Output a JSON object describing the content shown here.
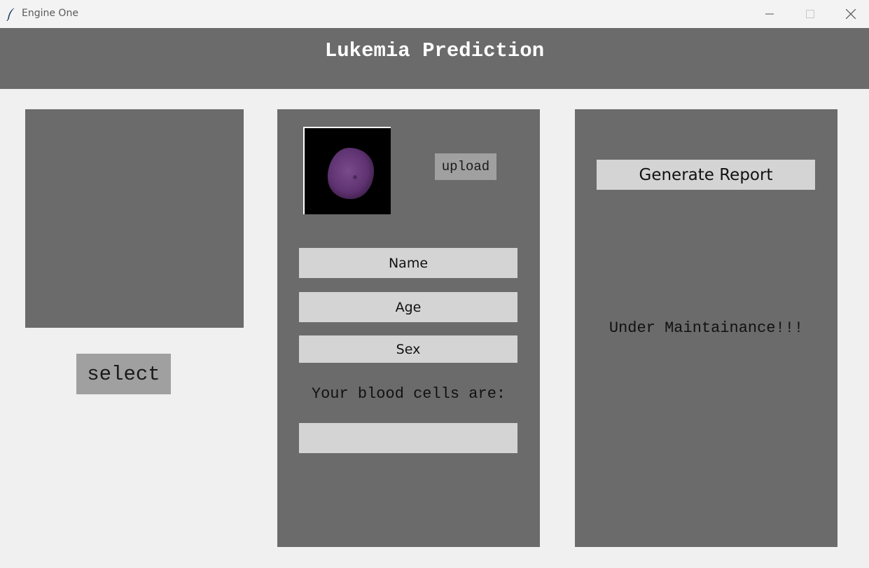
{
  "window": {
    "title": "Engine One",
    "controls": [
      "minimize-icon",
      "maximize-icon",
      "close-icon"
    ]
  },
  "header": {
    "title": "Lukemia Prediction"
  },
  "left_panel": {
    "select_label": "select"
  },
  "middle_panel": {
    "upload_label": "upload",
    "name_placeholder": "Name",
    "age_placeholder": "Age",
    "sex_placeholder": "Sex",
    "result_label": "Your blood cells are:",
    "result_value": ""
  },
  "right_panel": {
    "generate_label": "Generate Report",
    "status_text": "Under Maintainance!!!"
  },
  "colors": {
    "panel": "#6b6b6b",
    "background": "#f0f0f0",
    "field": "#d4d4d4",
    "button": "#a0a0a0"
  }
}
